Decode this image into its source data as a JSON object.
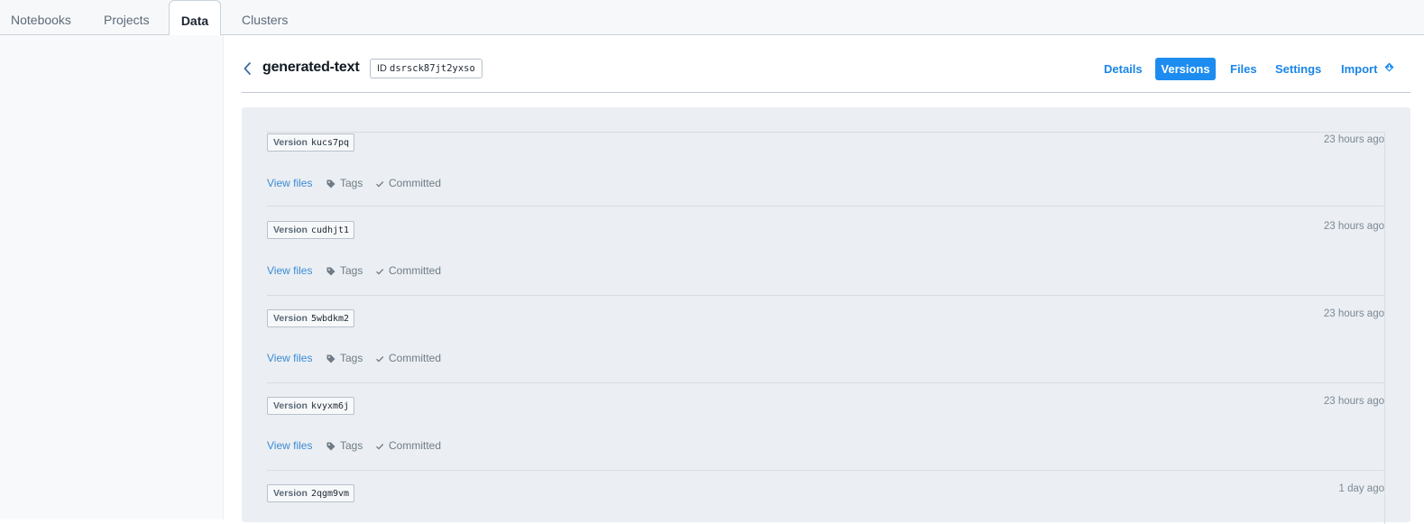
{
  "tabs": [
    {
      "label": "Notebooks",
      "active": false
    },
    {
      "label": "Projects",
      "active": false
    },
    {
      "label": "Data",
      "active": true
    },
    {
      "label": "Clusters",
      "active": false
    }
  ],
  "dataset": {
    "name": "generated-text",
    "id_label": "ID",
    "id": "dsrsck87jt2yxso"
  },
  "nav": {
    "details": "Details",
    "versions": "Versions",
    "files": "Files",
    "settings": "Settings",
    "import": "Import"
  },
  "versions": [
    {
      "label": "Version",
      "id": "kucs7pq",
      "time": "23 hours ago",
      "view_files": "View files",
      "tags": "Tags",
      "status": "Committed"
    },
    {
      "label": "Version",
      "id": "cudhjt1",
      "time": "23 hours ago",
      "view_files": "View files",
      "tags": "Tags",
      "status": "Committed"
    },
    {
      "label": "Version",
      "id": "5wbdkm2",
      "time": "23 hours ago",
      "view_files": "View files",
      "tags": "Tags",
      "status": "Committed"
    },
    {
      "label": "Version",
      "id": "kvyxm6j",
      "time": "23 hours ago",
      "view_files": "View files",
      "tags": "Tags",
      "status": "Committed"
    },
    {
      "label": "Version",
      "id": "2qgm9vm",
      "time": "1 day ago"
    }
  ],
  "colors": {
    "accent": "#1d8cf0",
    "link": "#3c8ad4",
    "panel_bg": "#ebeff3"
  }
}
